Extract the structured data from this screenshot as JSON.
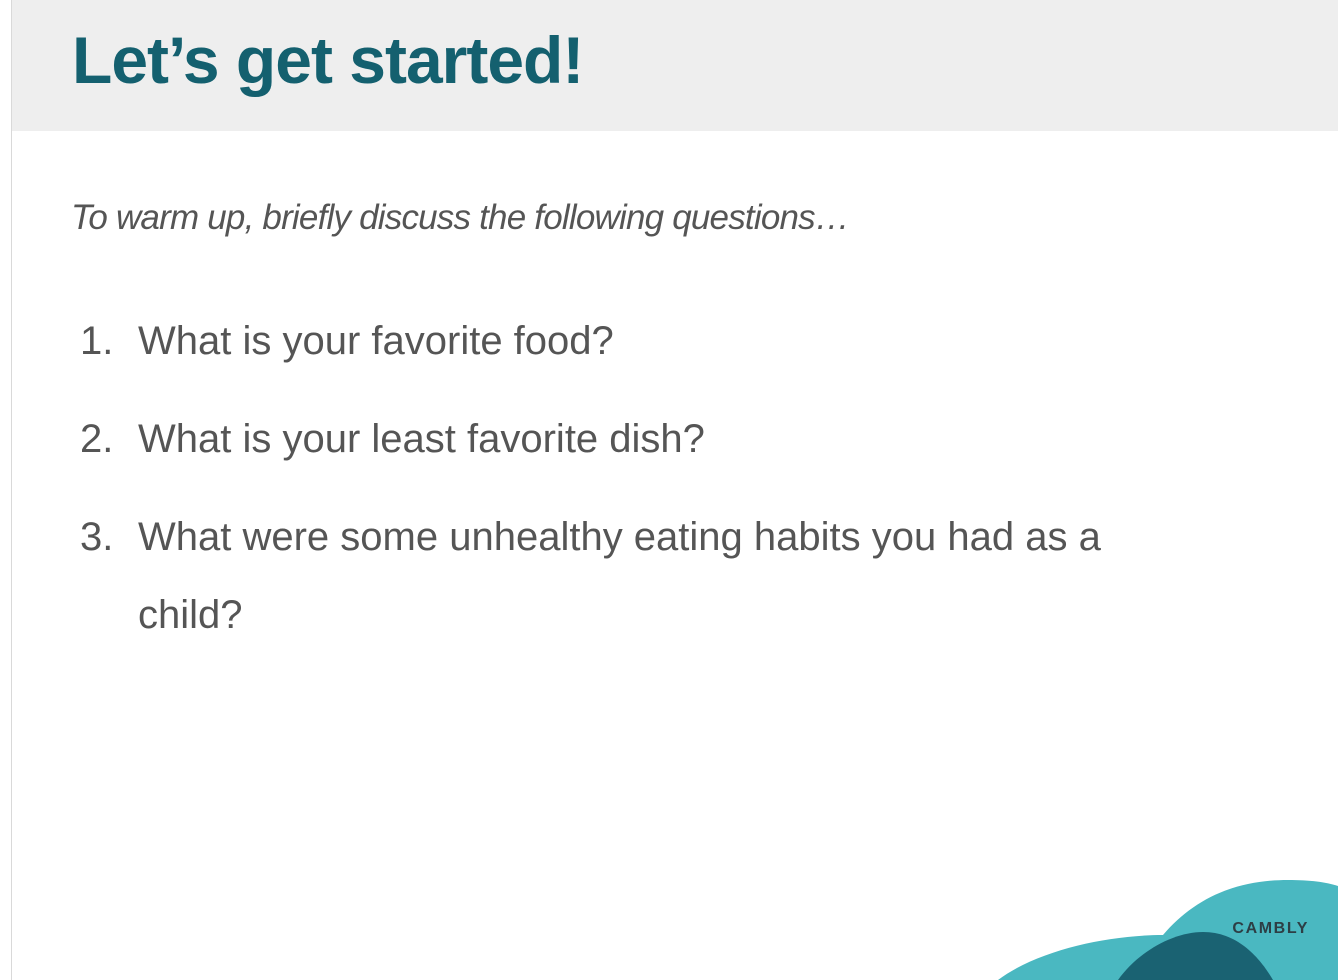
{
  "slide": {
    "title": "Let’s get started!",
    "intro": "To warm up, briefly discuss the following questions…",
    "questions": [
      {
        "number": "1.",
        "text": "What is your favorite food?"
      },
      {
        "number": "2.",
        "text": "What is your least favorite dish?"
      },
      {
        "number": "3.",
        "text": "What were some unhealthy eating habits you had as a child?"
      }
    ]
  },
  "brand": {
    "label": "CAMBLY",
    "colors": {
      "light": "#4ab8c1",
      "dark": "#1a6272"
    }
  },
  "colors": {
    "title": "#14606f",
    "body_text": "#555555",
    "header_bg": "#eeeeee"
  }
}
